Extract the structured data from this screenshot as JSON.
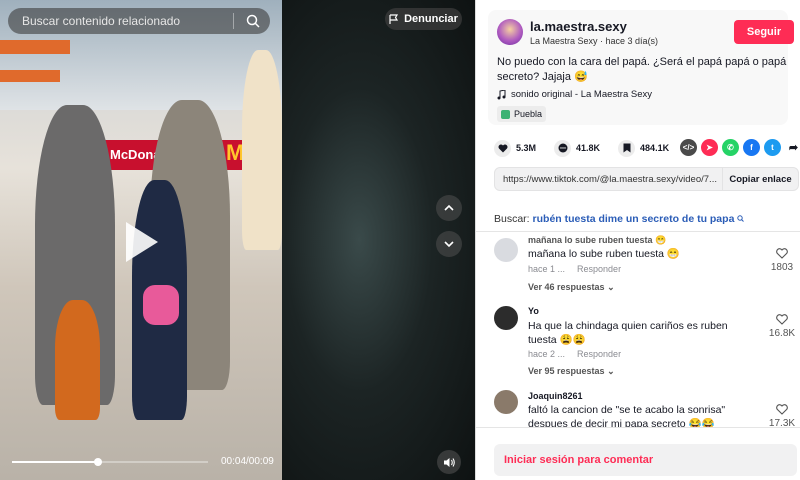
{
  "video": {
    "search_placeholder": "Buscar contenido relacionado",
    "report_label": "Denunciar",
    "time": "00:04/00:09",
    "progress_fraction": 0.44,
    "store_sign": "McDonald's"
  },
  "post": {
    "username": "la.maestra.sexy",
    "meta": "La Maestra Sexy · hace 3 día(s)",
    "follow_label": "Seguir",
    "description": "No puedo con la cara del papá. ¿Será el papá papá o papá secreto? Jajaja 😅",
    "sound": "sonido original - La Maestra Sexy",
    "location": "Puebla"
  },
  "stats": {
    "likes": "5.3M",
    "comments": "41.8K",
    "saves": "484.1K"
  },
  "share_icons": [
    "embed-icon",
    "send-icon",
    "whatsapp-icon",
    "facebook-icon",
    "twitter-icon",
    "forward-icon"
  ],
  "link": {
    "url": "https://www.tiktok.com/@la.maestra.sexy/video/7...",
    "copy_label": "Copiar enlace"
  },
  "related_search": {
    "prefix": "Buscar:",
    "query": "rubén tuesta dime un secreto de tu papa"
  },
  "comments": [
    {
      "name": "mañana lo sube ruben tuesta 😁",
      "text": "mañana lo sube ruben tuesta 😁",
      "time": "hace 1 ...",
      "reply_label": "Responder",
      "replies_label": "Ver 46 respuestas",
      "likes": "1803"
    },
    {
      "name": "Yo",
      "text": "Ha que la chindaga quien cariños es ruben tuesta 😩😩",
      "time": "hace 2 ...",
      "reply_label": "Responder",
      "replies_label": "Ver 95 respuestas",
      "likes": "16.8K"
    },
    {
      "name": "Joaquin8261",
      "text": "faltó la cancion de \"se te acabo la sonrisa\" despues de decir mi papa secreto 😂😂",
      "time": "",
      "reply_label": "",
      "replies_label": "",
      "likes": "17.3K"
    }
  ],
  "login_prompt": "Iniciar sesión para comentar",
  "colors": {
    "accent": "#fe2c55",
    "link": "#2b5db7"
  }
}
